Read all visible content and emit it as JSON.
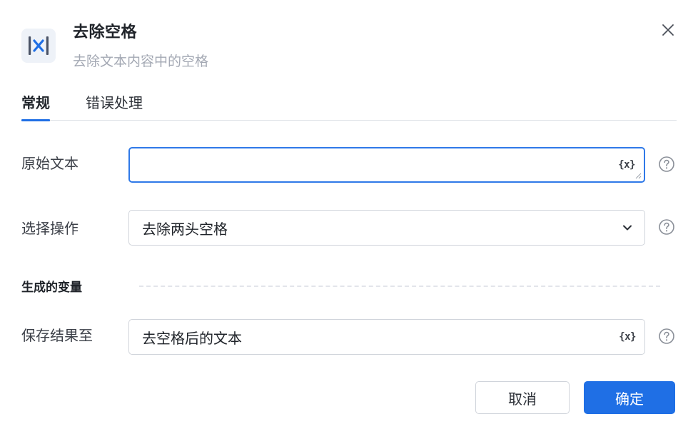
{
  "dialog": {
    "title": "去除空格",
    "subtitle": "去除文本内容中的空格",
    "icon": "remove-space-icon",
    "close_icon": "close-icon"
  },
  "tabs": [
    {
      "label": "常规",
      "active": true
    },
    {
      "label": "错误处理",
      "active": false
    }
  ],
  "fields": {
    "original_text": {
      "label": "原始文本",
      "value": "",
      "var_icon_text": "{x}"
    },
    "operation": {
      "label": "选择操作",
      "selected": "去除两头空格"
    },
    "section_title": "生成的变量",
    "save_result": {
      "label": "保存结果至",
      "value": "去空格后的文本",
      "var_icon_text": "{x}"
    }
  },
  "buttons": {
    "cancel": "取消",
    "confirm": "确定"
  },
  "colors": {
    "accent": "#1f6fe5",
    "focus_border": "#2f79e8",
    "muted_text": "#a3a8b3"
  }
}
